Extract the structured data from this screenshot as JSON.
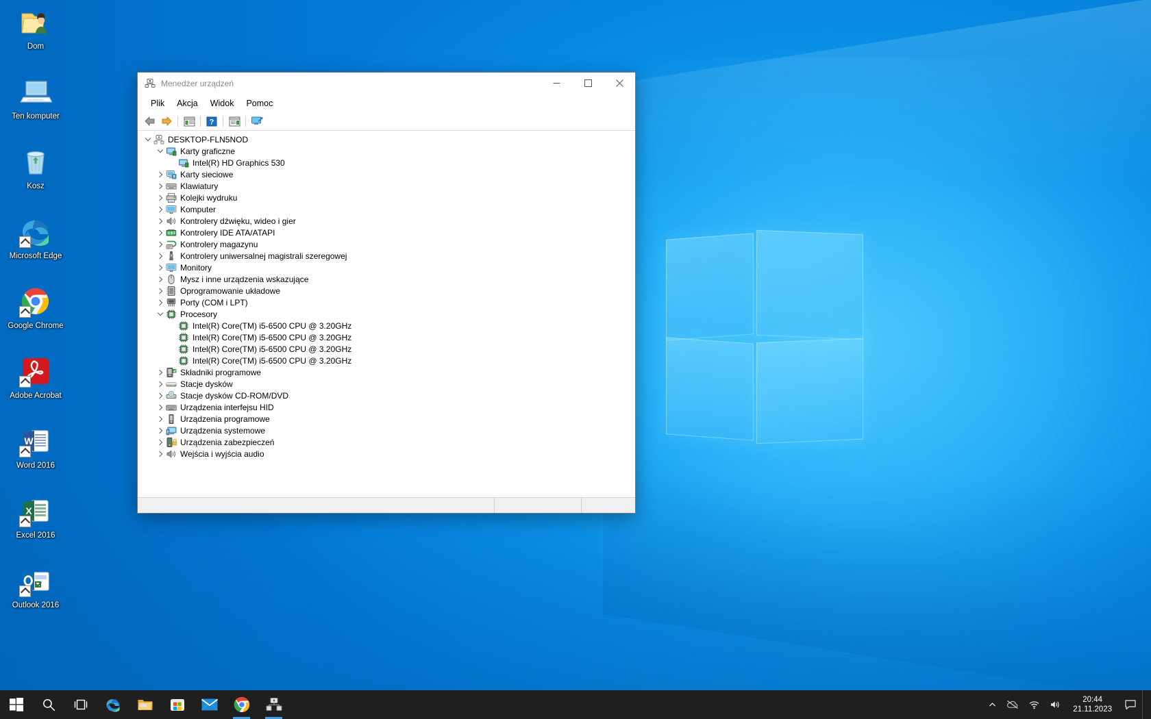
{
  "desktop": {
    "icons": [
      {
        "label": "Dom",
        "icon": "user-folder-icon",
        "shortcut": false
      },
      {
        "label": "Ten komputer",
        "icon": "this-pc-icon",
        "shortcut": false
      },
      {
        "label": "Kosz",
        "icon": "recycle-bin-icon",
        "shortcut": false
      },
      {
        "label": "Microsoft Edge",
        "icon": "edge-icon",
        "shortcut": true
      },
      {
        "label": "Google Chrome",
        "icon": "chrome-icon",
        "shortcut": true
      },
      {
        "label": "Adobe Acrobat",
        "icon": "acrobat-icon",
        "shortcut": true
      },
      {
        "label": "Word 2016",
        "icon": "word-icon",
        "shortcut": true
      },
      {
        "label": "Excel 2016",
        "icon": "excel-icon",
        "shortcut": true
      },
      {
        "label": "Outlook 2016",
        "icon": "outlook-icon",
        "shortcut": true
      }
    ]
  },
  "window": {
    "title": "Menedżer urządzeń",
    "title_icon": "device-manager-icon",
    "controls": {
      "minimize": "─",
      "maximize": "□",
      "close": "✕"
    },
    "menu": [
      "Plik",
      "Akcja",
      "Widok",
      "Pomoc"
    ],
    "toolbar": [
      {
        "name": "back-button",
        "icon": "back-arrow-icon"
      },
      {
        "name": "forward-button",
        "icon": "forward-arrow-icon"
      },
      {
        "name": "properties-button",
        "icon": "properties-icon"
      },
      {
        "name": "help-button",
        "icon": "help-icon"
      },
      {
        "name": "update-driver-button",
        "icon": "update-driver-icon"
      },
      {
        "name": "scan-hardware-button",
        "icon": "scan-hardware-icon"
      }
    ],
    "status_text": ""
  },
  "tree": {
    "root": {
      "label": "DESKTOP-FLN5NOD",
      "icon": "computer-root-icon",
      "expanded": true
    },
    "nodes": [
      {
        "label": "Karty graficzne",
        "icon": "display-adapter-icon",
        "level": 1,
        "state": "open"
      },
      {
        "label": "Intel(R) HD Graphics 530",
        "icon": "display-adapter-icon",
        "level": 2,
        "state": "leaf"
      },
      {
        "label": "Karty sieciowe",
        "icon": "network-adapter-icon",
        "level": 1,
        "state": "closed"
      },
      {
        "label": "Klawiatury",
        "icon": "keyboard-icon",
        "level": 1,
        "state": "closed"
      },
      {
        "label": "Kolejki wydruku",
        "icon": "printer-icon",
        "level": 1,
        "state": "closed"
      },
      {
        "label": "Komputer",
        "icon": "computer-icon",
        "level": 1,
        "state": "closed"
      },
      {
        "label": "Kontrolery dźwięku, wideo i gier",
        "icon": "sound-icon",
        "level": 1,
        "state": "closed"
      },
      {
        "label": "Kontrolery IDE ATA/ATAPI",
        "icon": "ide-controller-icon",
        "level": 1,
        "state": "closed"
      },
      {
        "label": "Kontrolery magazynu",
        "icon": "storage-controller-icon",
        "level": 1,
        "state": "closed"
      },
      {
        "label": "Kontrolery uniwersalnej magistrali szeregowej",
        "icon": "usb-icon",
        "level": 1,
        "state": "closed"
      },
      {
        "label": "Monitory",
        "icon": "monitor-icon",
        "level": 1,
        "state": "closed"
      },
      {
        "label": "Mysz i inne urządzenia wskazujące",
        "icon": "mouse-icon",
        "level": 1,
        "state": "closed"
      },
      {
        "label": "Oprogramowanie układowe",
        "icon": "firmware-icon",
        "level": 1,
        "state": "closed"
      },
      {
        "label": "Porty (COM i LPT)",
        "icon": "port-icon",
        "level": 1,
        "state": "closed"
      },
      {
        "label": "Procesory",
        "icon": "processor-icon",
        "level": 1,
        "state": "open"
      },
      {
        "label": "Intel(R) Core(TM) i5-6500 CPU @ 3.20GHz",
        "icon": "processor-icon",
        "level": 2,
        "state": "leaf"
      },
      {
        "label": "Intel(R) Core(TM) i5-6500 CPU @ 3.20GHz",
        "icon": "processor-icon",
        "level": 2,
        "state": "leaf"
      },
      {
        "label": "Intel(R) Core(TM) i5-6500 CPU @ 3.20GHz",
        "icon": "processor-icon",
        "level": 2,
        "state": "leaf"
      },
      {
        "label": "Intel(R) Core(TM) i5-6500 CPU @ 3.20GHz",
        "icon": "processor-icon",
        "level": 2,
        "state": "leaf"
      },
      {
        "label": "Składniki programowe",
        "icon": "software-component-icon",
        "level": 1,
        "state": "closed"
      },
      {
        "label": "Stacje dysków",
        "icon": "disk-drive-icon",
        "level": 1,
        "state": "closed"
      },
      {
        "label": "Stacje dysków CD-ROM/DVD",
        "icon": "cdrom-icon",
        "level": 1,
        "state": "closed"
      },
      {
        "label": "Urządzenia interfejsu HID",
        "icon": "hid-icon",
        "level": 1,
        "state": "closed"
      },
      {
        "label": "Urządzenia programowe",
        "icon": "software-device-icon",
        "level": 1,
        "state": "closed"
      },
      {
        "label": "Urządzenia systemowe",
        "icon": "system-device-icon",
        "level": 1,
        "state": "closed"
      },
      {
        "label": "Urządzenia zabezpieczeń",
        "icon": "security-device-icon",
        "level": 1,
        "state": "closed"
      },
      {
        "label": "Wejścia i wyjścia audio",
        "icon": "audio-io-icon",
        "level": 1,
        "state": "closed"
      }
    ]
  },
  "taskbar": {
    "items": [
      {
        "name": "start-button",
        "icon": "windows-logo-icon",
        "active": false
      },
      {
        "name": "search-button",
        "icon": "search-icon",
        "active": false
      },
      {
        "name": "task-view-button",
        "icon": "task-view-icon",
        "active": false
      },
      {
        "name": "taskbar-edge",
        "icon": "edge-icon",
        "active": false
      },
      {
        "name": "taskbar-file-explorer",
        "icon": "folder-icon",
        "active": false
      },
      {
        "name": "taskbar-microsoft-store",
        "icon": "store-icon",
        "active": false
      },
      {
        "name": "taskbar-mail",
        "icon": "mail-icon",
        "active": false
      },
      {
        "name": "taskbar-chrome",
        "icon": "chrome-icon",
        "active": true
      },
      {
        "name": "taskbar-device-manager",
        "icon": "device-manager-icon",
        "active": true
      }
    ],
    "tray": [
      {
        "name": "show-hidden-icons-button",
        "icon": "chevron-up-icon"
      },
      {
        "name": "onedrive-tray-icon",
        "icon": "cloud-offline-icon"
      },
      {
        "name": "network-tray-icon",
        "icon": "wifi-icon"
      },
      {
        "name": "volume-tray-icon",
        "icon": "speaker-icon"
      }
    ],
    "clock": {
      "time": "20:44",
      "date": "21.11.2023"
    },
    "action_center": {
      "name": "action-center-button",
      "icon": "notification-icon"
    }
  },
  "colors": {
    "accent": "#0078d7",
    "taskbar": "#1f1f1f",
    "desktop_blue": "#0a8fe0",
    "active_indicator": "#3aa0e8"
  }
}
